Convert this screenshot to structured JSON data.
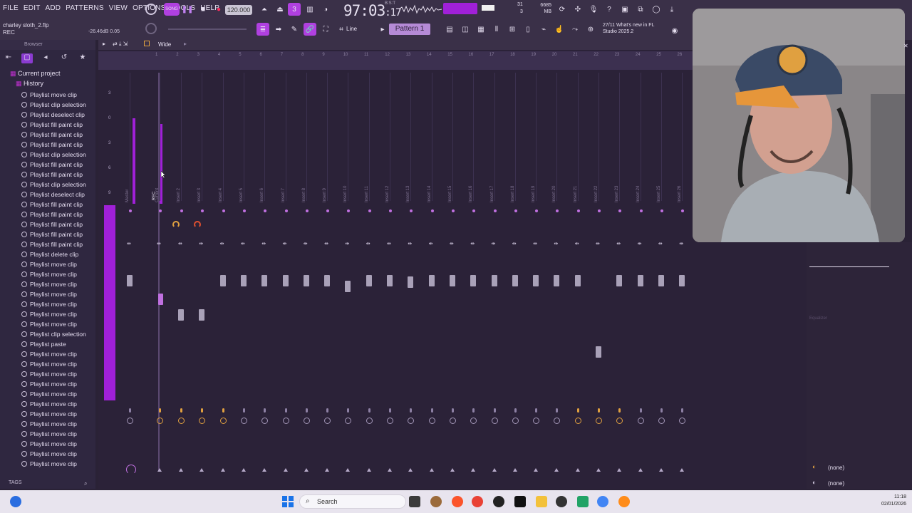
{
  "menu": [
    "FILE",
    "EDIT",
    "ADD",
    "PATTERNS",
    "VIEW",
    "OPTIONS",
    "TOOLS",
    "HELP"
  ],
  "toolbar": {
    "tempo": "120.000",
    "clock": "97:03",
    "clock_frac": ":17",
    "clock_sub": "B:S:T",
    "mem": "6685 MB",
    "cpu_a": "31",
    "cpu_b": "3",
    "pattern": "Pattern 1",
    "line_mode": "Line",
    "news_top": "27/11  What's new in FL",
    "news_bottom": "Studio 2025.2"
  },
  "song": {
    "name": "charley sloth_2.flp",
    "mode": "REC",
    "level": "-26.46dB  0.05"
  },
  "browser": {
    "title": "Browser",
    "current_project": "Current project",
    "history": "History",
    "items": [
      "Playlist move clip",
      "Playlist clip selection",
      "Playlist deselect clip",
      "Playlist fill paint clip",
      "Playlist fill paint clip",
      "Playlist fill paint clip",
      "Playlist clip selection",
      "Playlist fill paint clip",
      "Playlist fill paint clip",
      "Playlist clip selection",
      "Playlist deselect clip",
      "Playlist fill paint clip",
      "Playlist fill paint clip",
      "Playlist fill paint clip",
      "Playlist fill paint clip",
      "Playlist fill paint clip",
      "Playlist delete clip",
      "Playlist move clip",
      "Playlist move clip",
      "Playlist move clip",
      "Playlist move clip",
      "Playlist move clip",
      "Playlist move clip",
      "Playlist move clip",
      "Playlist clip selection",
      "Playlist paste",
      "Playlist move clip",
      "Playlist move clip",
      "Playlist move clip",
      "Playlist move clip",
      "Playlist move clip",
      "Playlist move clip",
      "Playlist move clip",
      "Playlist move clip",
      "Playlist move clip",
      "Playlist move clip",
      "Playlist move clip",
      "Playlist move clip"
    ],
    "tags": "TAGS"
  },
  "mixer": {
    "label": "Wide",
    "master": "Master",
    "current": "Current",
    "rec": "REC",
    "inserts": [
      "Insert 2",
      "Insert 3",
      "Insert 4",
      "Insert 5",
      "Insert 6",
      "Insert 7",
      "Insert 8",
      "Insert 9",
      "Insert 10",
      "Insert 11",
      "Insert 12",
      "Insert 13",
      "Insert 14",
      "Insert 15",
      "Insert 16",
      "Insert 17",
      "Insert 18",
      "Insert 19",
      "Insert 20",
      "Insert 21",
      "Insert 22",
      "Insert 23",
      "Insert 24",
      "Insert 25",
      "Insert 26"
    ],
    "scale": [
      "3",
      "0",
      "3",
      "6",
      "9"
    ],
    "ruler": [
      "1",
      "2",
      "3",
      "4",
      "5",
      "6",
      "7",
      "8",
      "9",
      "10",
      "11",
      "12",
      "13",
      "14",
      "15",
      "16",
      "17",
      "18",
      "19",
      "20",
      "21",
      "22",
      "23",
      "24",
      "25",
      "26"
    ]
  },
  "right_panel": {
    "slot1": "(none)",
    "slot2": "(none)",
    "eq_label": "Equalizer"
  },
  "taskbar": {
    "search": "Search",
    "time": "11:18",
    "date": "02/01/2026"
  },
  "colors": {
    "accent": "#a020d8",
    "background": "#2b2238",
    "panel": "#3a3048"
  }
}
